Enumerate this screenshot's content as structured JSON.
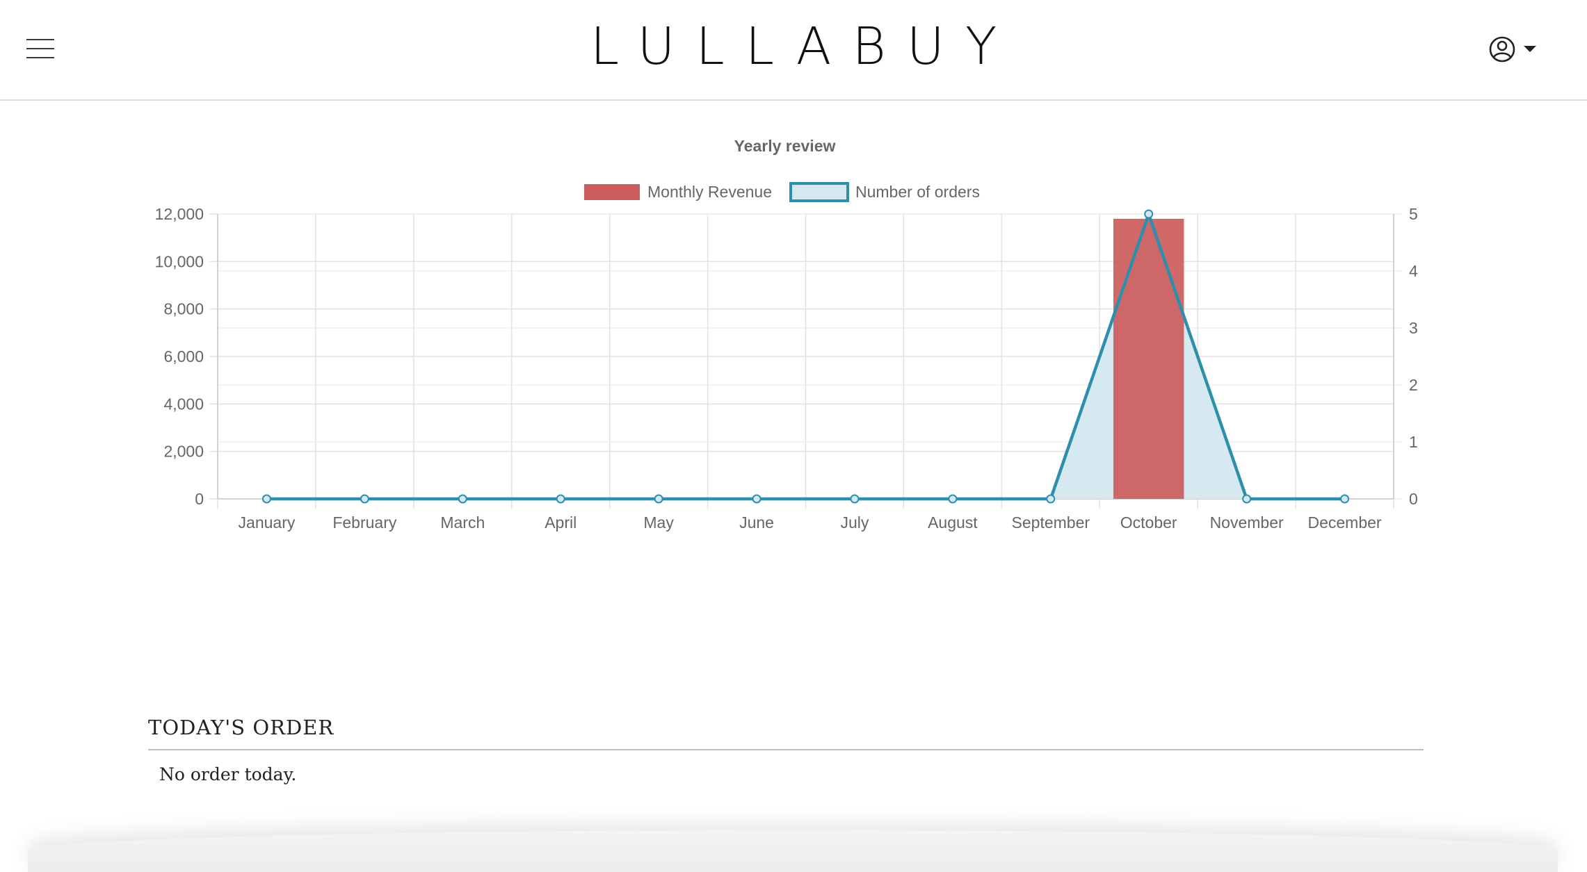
{
  "header": {
    "brand": "LULLABUY",
    "menu_icon": "hamburger-menu-icon",
    "user_icon": "user-circle-icon",
    "dropdown_icon": "caret-down-icon"
  },
  "chart_data": {
    "type": "bar",
    "title": "Yearly review",
    "categories": [
      "January",
      "February",
      "March",
      "April",
      "May",
      "June",
      "July",
      "August",
      "September",
      "October",
      "November",
      "December"
    ],
    "series": [
      {
        "name": "Monthly Revenue",
        "type": "bar",
        "axis": "left",
        "color": "#cd5c5c",
        "values": [
          0,
          0,
          0,
          0,
          0,
          0,
          0,
          0,
          0,
          11800,
          0,
          0
        ]
      },
      {
        "name": "Number of orders",
        "type": "line",
        "axis": "right",
        "color": "#2e8fad",
        "fill": "#d5e8ef",
        "values": [
          0,
          0,
          0,
          0,
          0,
          0,
          0,
          0,
          0,
          5,
          0,
          0
        ]
      }
    ],
    "y_left": {
      "min": 0,
      "max": 12000,
      "ticks": [
        0,
        2000,
        4000,
        6000,
        8000,
        10000,
        12000
      ],
      "tick_labels": [
        "0",
        "2,000",
        "4,000",
        "6,000",
        "8,000",
        "10,000",
        "12,000"
      ]
    },
    "y_right": {
      "min": 0,
      "max": 5,
      "ticks": [
        0,
        1,
        2,
        3,
        4,
        5
      ],
      "tick_labels": [
        "0",
        "1",
        "2",
        "3",
        "4",
        "5"
      ]
    },
    "legend": "top",
    "grid": true
  },
  "orders": {
    "title": "TODAY'S ORDER",
    "empty_message": "No order today."
  }
}
